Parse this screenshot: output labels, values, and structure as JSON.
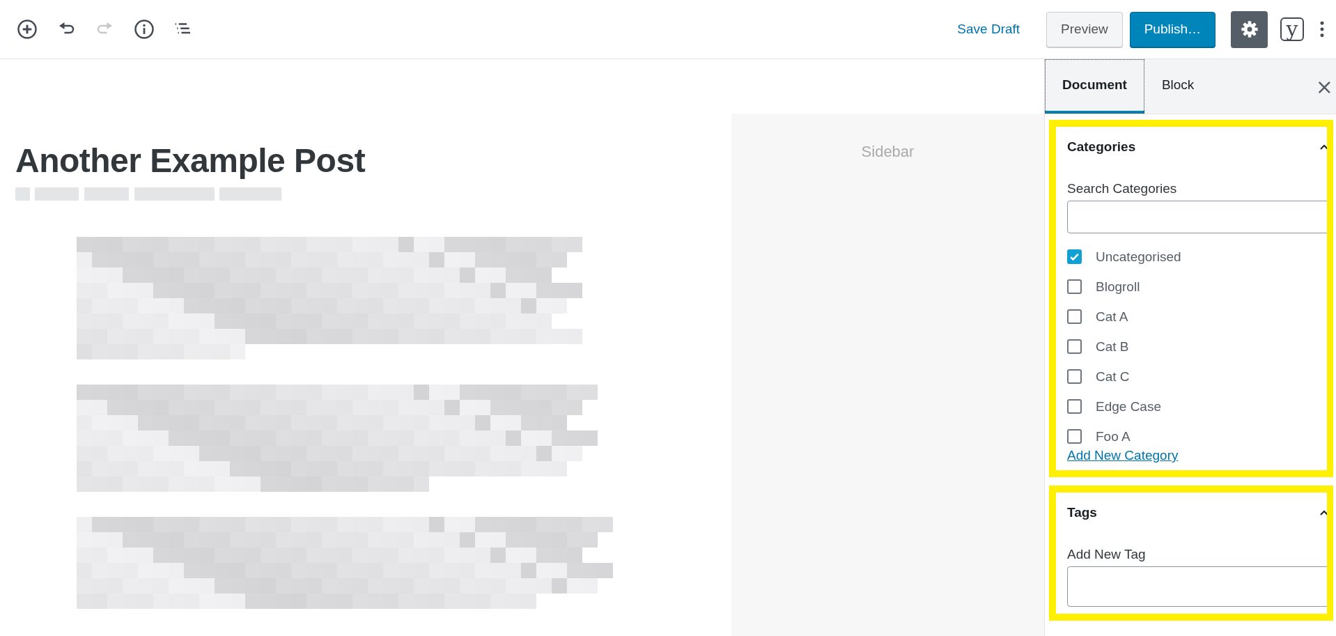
{
  "toolbar": {
    "undo_disabled": false,
    "redo_disabled": true
  },
  "actions": {
    "save_draft": "Save Draft",
    "preview": "Preview",
    "publish": "Publish…",
    "settings_selected": true,
    "seo_glyph": "y"
  },
  "post": {
    "title": "Another Example Post",
    "theme_sidebar_label": "Sidebar"
  },
  "sidebar": {
    "tabs": [
      {
        "label": "Document",
        "selected": true
      },
      {
        "label": "Block",
        "selected": false
      }
    ],
    "close": "×",
    "categories": {
      "heading": "Categories",
      "search_label": "Search Categories",
      "items": [
        {
          "label": "Uncategorised",
          "checked": true
        },
        {
          "label": "Blogroll",
          "checked": false
        },
        {
          "label": "Cat A",
          "checked": false
        },
        {
          "label": "Cat B",
          "checked": false
        },
        {
          "label": "Cat C",
          "checked": false
        },
        {
          "label": "Edge Case",
          "checked": false
        },
        {
          "label": "Foo A",
          "checked": false
        }
      ],
      "add_link": "Add New Category"
    },
    "tags": {
      "heading": "Tags",
      "input_label": "Add New Tag"
    }
  }
}
